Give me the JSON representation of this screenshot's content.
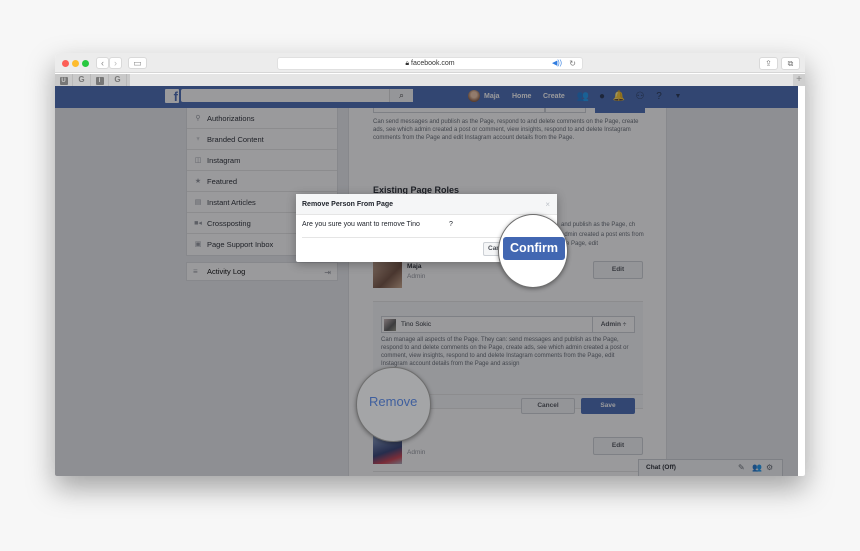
{
  "browser": {
    "url": "facebook.com",
    "lock_icon": "lock-icon",
    "back_icon": "‹",
    "forward_icon": "›",
    "sidebar_icon": "▭",
    "audio_icon": "◀))",
    "reload_icon": "↻",
    "share_icon": "⇪",
    "tabs_icon": "⧉",
    "favorites": [
      "U",
      "G",
      "I",
      "G"
    ],
    "new_tab": "+"
  },
  "facebook": {
    "logo": "f",
    "search_value": "",
    "search_icon": "⌕",
    "user_name": "Maja",
    "nav_home": "Home",
    "nav_create": "Create",
    "icons": {
      "friends": "👥",
      "messenger": "●",
      "notifications": "🔔",
      "requests": "⚇",
      "help": "?",
      "dropdown": "▼"
    }
  },
  "leftnav": {
    "items": [
      {
        "icon": "⚲",
        "label": "Authorizations"
      },
      {
        "icon": "♆",
        "label": "Branded Content"
      },
      {
        "icon": "◫",
        "label": "Instagram"
      },
      {
        "icon": "★",
        "label": "Featured"
      },
      {
        "icon": "▤",
        "label": "Instant Articles"
      },
      {
        "icon": "■◂",
        "label": "Crossposting"
      },
      {
        "icon": "▣",
        "label": "Page Support Inbox"
      }
    ],
    "activity_log": {
      "icon": "≡",
      "label": "Activity Log",
      "exit_icon": "⇥"
    }
  },
  "main": {
    "top_description": "Can send messages and publish as the Page, respond to and delete comments on the Page, create ads, see which admin created a post or comment, view insights, respond to and delete Instagram comments from the Page and edit Instagram account details from the Page.",
    "section_title": "Existing Page Roles",
    "bg_description": "and publish as the Page, ch admin created a post ents from the Page, edit",
    "people": [
      {
        "name": "Maja",
        "role": "Admin",
        "edit_label": "Edit"
      },
      {
        "name": "",
        "role": "Admin",
        "edit_label": "Edit"
      }
    ],
    "edit_box": {
      "name": "Tino Sokic",
      "role_select": "Admin ÷",
      "description": "Can manage all aspects of the Page. They can: send messages and publish as the Page, respond to and delete comments on the Page, create ads, see which admin created a post or comment, view insights, respond to and delete Instagram comments from the Page, edit Instagram account details from the Page and assign",
      "cancel_label": "Cancel",
      "save_label": "Save"
    }
  },
  "chat": {
    "label": "Chat (Off)",
    "compose_icon": "✎",
    "people_icon": "👥",
    "settings_icon": "⚙"
  },
  "dialog": {
    "title": "Remove Person From Page",
    "close_icon": "×",
    "message": "Are you sure you want to remove Tino",
    "question_mark": "?",
    "cancel_label": "Cancel",
    "confirm_label": "Confirm"
  },
  "callouts": {
    "remove_label": "Remove",
    "confirm_label": "Confirm"
  }
}
